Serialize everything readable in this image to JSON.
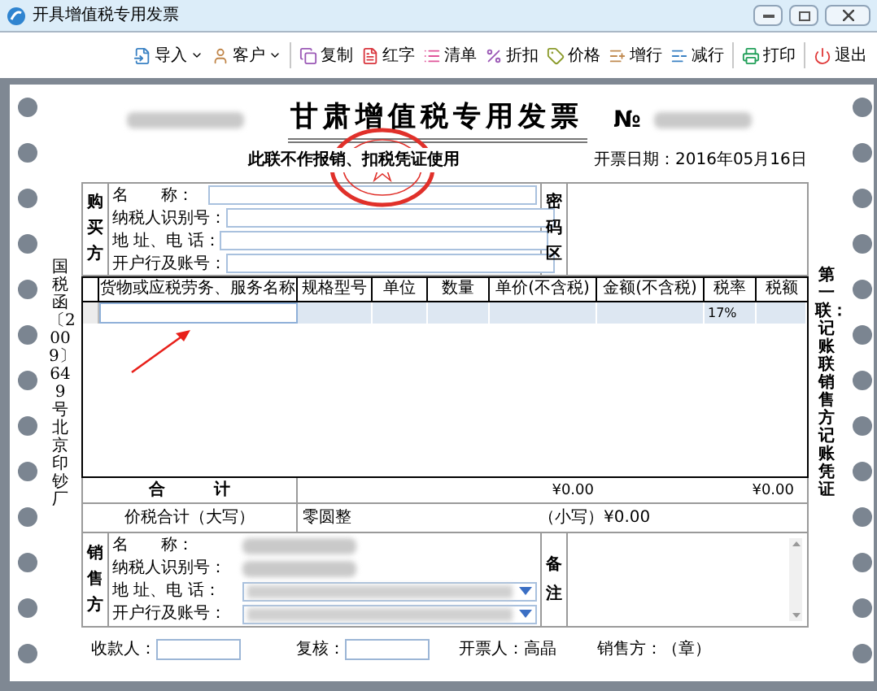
{
  "window": {
    "title": "开具增值税专用发票"
  },
  "toolbar": {
    "buttons": [
      {
        "label": "导入",
        "has_dropdown": true,
        "separator_before": false
      },
      {
        "label": "客户",
        "has_dropdown": true,
        "separator_before": false
      },
      {
        "label": "复制",
        "has_dropdown": false,
        "separator_before": true
      },
      {
        "label": "红字",
        "has_dropdown": false,
        "separator_before": false
      },
      {
        "label": "清单",
        "has_dropdown": false,
        "separator_before": false
      },
      {
        "label": "折扣",
        "has_dropdown": false,
        "separator_before": false
      },
      {
        "label": "价格",
        "has_dropdown": false,
        "separator_before": false
      },
      {
        "label": "增行",
        "has_dropdown": false,
        "separator_before": false
      },
      {
        "label": "减行",
        "has_dropdown": false,
        "separator_before": false
      },
      {
        "label": "打印",
        "has_dropdown": false,
        "separator_before": true
      },
      {
        "label": "退出",
        "has_dropdown": false,
        "separator_before": true
      }
    ]
  },
  "invoice": {
    "title": "甘肃增值税专用发票",
    "number_label": "№",
    "notice": "此联不作报销、扣税凭证使用",
    "issue_date": "开票日期：2016年05月16日",
    "side_text_left": "国税函〔2009〕649号北京印钞厂",
    "side_text_right": "第一联：记账联销售方记账凭证",
    "buyer": {
      "label": "购买方",
      "fields": [
        {
          "label": "名　　称：",
          "kind": "input"
        },
        {
          "label": "纳税人识别号：",
          "kind": "input"
        },
        {
          "label": "地 址、电 话：",
          "kind": "input"
        },
        {
          "label": "开户行及账号：",
          "kind": "input"
        }
      ],
      "password_label": "密码区"
    },
    "items_table": {
      "columns": [
        "货物或应税劳务、服务名称",
        "规格型号",
        "单位",
        "数量",
        "单价(不含税)",
        "金额(不含税)",
        "税率",
        "税额"
      ],
      "rows": [
        {
          "tax_rate": "17%"
        }
      ]
    },
    "total": {
      "label": "合　　　计",
      "amount": "¥0.00",
      "tax": "¥0.00"
    },
    "grand_total": {
      "label": "价税合计（大写）",
      "in_words": "零圆整",
      "in_figures": "（小写）¥0.00"
    },
    "seller": {
      "label": "销售方",
      "fields": [
        {
          "label": "名　　称：",
          "kind": "redacted"
        },
        {
          "label": "纳税人识别号：",
          "kind": "redacted"
        },
        {
          "label": "地 址、电 话：",
          "kind": "dropdown"
        },
        {
          "label": "开户行及账号：",
          "kind": "dropdown"
        }
      ],
      "remarks_label": "备注"
    },
    "footer": {
      "payee_label": "收款人：",
      "reviewer_label": "复核：",
      "issuer_label": "开票人：",
      "issuer": "高晶",
      "seller_seal": "销售方：（章）"
    }
  }
}
